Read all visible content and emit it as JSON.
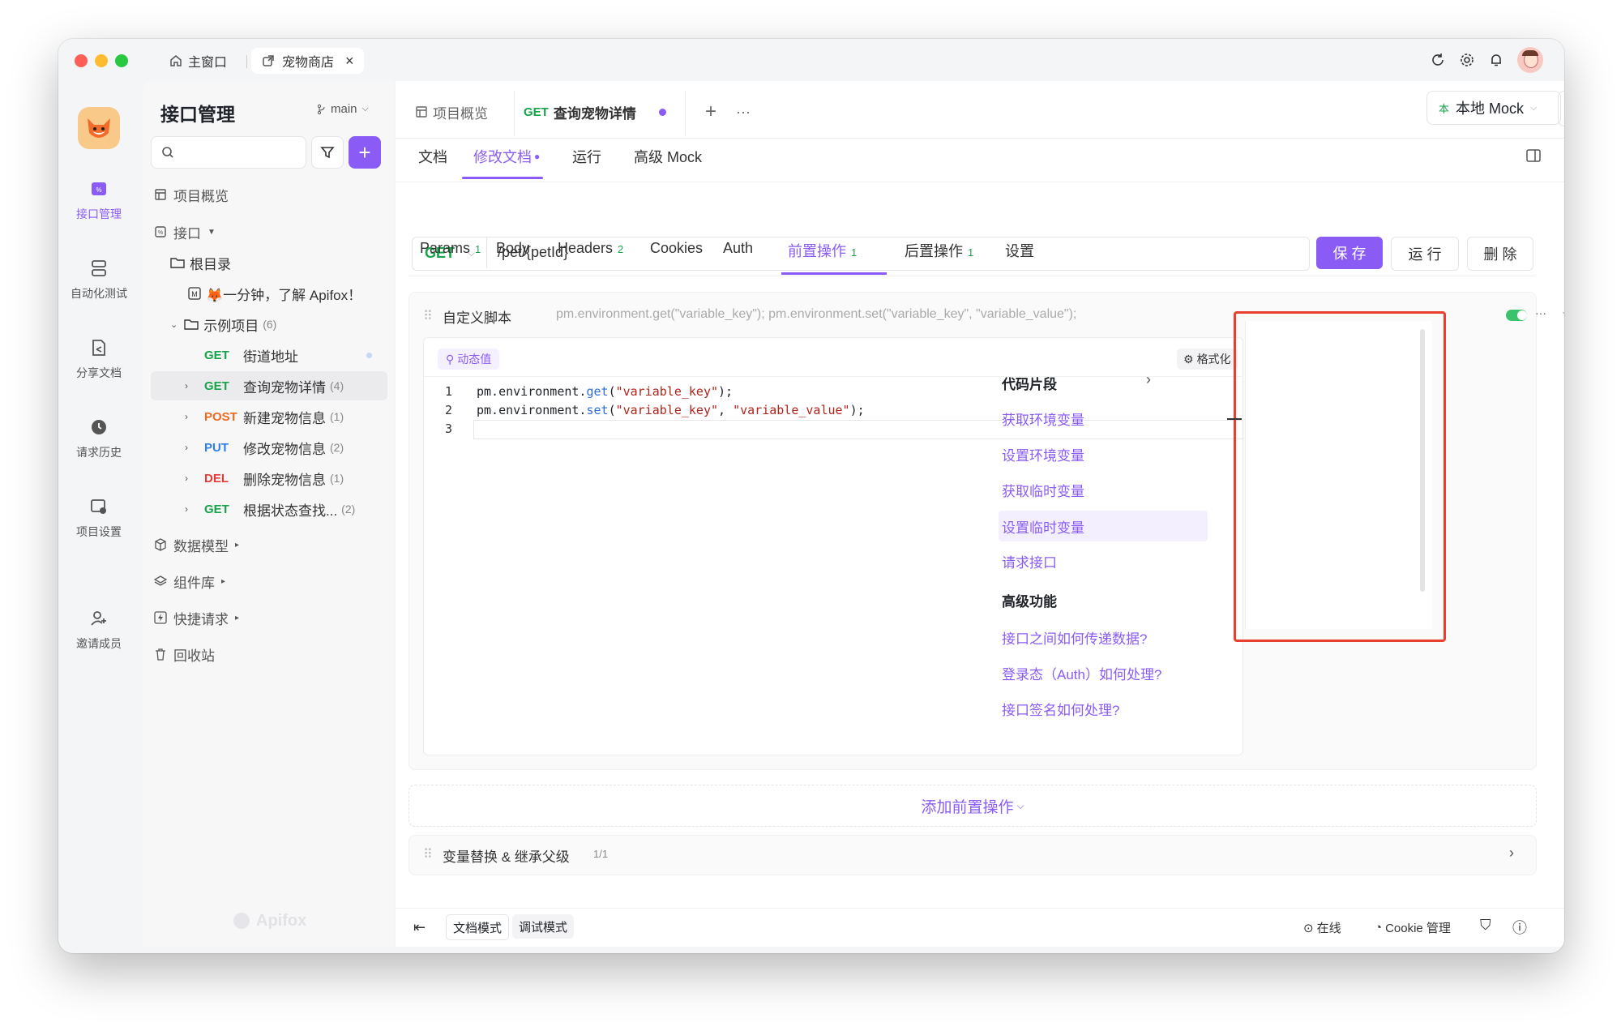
{
  "colors": {
    "accent": "#8a5cf5",
    "get": "#17a34a",
    "post": "#f2691e",
    "put": "#2f80ed",
    "delete": "#e53935",
    "highlight_border": "#e8402f"
  },
  "titlebar": {
    "tabs": [
      {
        "label": "主窗口",
        "icon": "home-icon"
      },
      {
        "label": "宠物商店",
        "icon": "external-link-icon"
      }
    ],
    "close_glyph": "×",
    "icons": [
      "refresh-icon",
      "settings-icon",
      "bell-icon",
      "avatar"
    ]
  },
  "rail": {
    "items": [
      {
        "label": "接口管理",
        "icon": "api-icon"
      },
      {
        "label": "自动化测试",
        "icon": "automation-icon"
      },
      {
        "label": "分享文档",
        "icon": "share-doc-icon"
      },
      {
        "label": "请求历史",
        "icon": "history-icon"
      },
      {
        "label": "项目设置",
        "icon": "project-settings-icon"
      },
      {
        "label": "邀请成员",
        "icon": "invite-icon"
      }
    ]
  },
  "sidebar": {
    "title": "接口管理",
    "branch": "main",
    "search_placeholder": "",
    "add_glyph": "+",
    "overview": "项目概览",
    "apis": "接口",
    "root": "根目录",
    "intro": "🦊一分钟，了解 Apifox！",
    "example": {
      "label": "示例项目",
      "count": "(6)"
    },
    "endpoints": [
      {
        "method": "GET",
        "label": "街道地址",
        "count": ""
      },
      {
        "method": "GET",
        "label": "查询宠物详情",
        "count": "(4)"
      },
      {
        "method": "POST",
        "label": "新建宠物信息",
        "count": "(1)"
      },
      {
        "method": "PUT",
        "label": "修改宠物信息",
        "count": "(2)"
      },
      {
        "method": "DEL",
        "label": "删除宠物信息",
        "count": "(1)"
      },
      {
        "method": "GET",
        "label": "根据状态查找...",
        "count": "(2)"
      }
    ],
    "data_models": "数据模型",
    "components": "组件库",
    "quick_request": "快捷请求",
    "recycle": "回收站",
    "watermark": "Apifox"
  },
  "main": {
    "overview_tab": "项目概览",
    "active_tab": {
      "method": "GET",
      "label": "查询宠物详情"
    },
    "add_glyph": "+",
    "more_glyph": "···",
    "env": {
      "badge": "本",
      "label": "本地 Mock"
    },
    "subtabs": {
      "doc": "文档",
      "edit": "修改文档",
      "run": "运行",
      "mock": "高级 Mock"
    },
    "request": {
      "method": "GET",
      "url": "/pet/{petId}"
    },
    "buttons": {
      "save": "保 存",
      "run": "运 行",
      "delete": "删 除"
    },
    "params_tabs": [
      {
        "label": "Params",
        "count": "1"
      },
      {
        "label": "Body",
        "count": ""
      },
      {
        "label": "Headers",
        "count": "2"
      },
      {
        "label": "Cookies",
        "count": ""
      },
      {
        "label": "Auth",
        "count": ""
      },
      {
        "label": "前置操作",
        "count": "1"
      },
      {
        "label": "后置操作",
        "count": "1"
      },
      {
        "label": "设置",
        "count": ""
      }
    ],
    "script": {
      "title": "自定义脚本",
      "preview": "pm.environment.get(\"variable_key\"); pm.environment.set(\"variable_key\", \"variable_value\");",
      "dynamic_value": "动态值",
      "format": "格式化",
      "line_numbers": [
        "1",
        "2",
        "3"
      ],
      "lines": [
        {
          "obj": "pm.environment.",
          "fn": "get",
          "args": [
            {
              "t": "str",
              "v": "\"variable_key\""
            }
          ],
          "tail": ");"
        },
        {
          "obj": "pm.environment.",
          "fn": "set",
          "args": [
            {
              "t": "str",
              "v": "\"variable_key\""
            },
            {
              "t": "sep",
              "v": ", "
            },
            {
              "t": "str",
              "v": "\"variable_value\""
            }
          ],
          "tail": ");"
        },
        {
          "obj": "",
          "fn": "",
          "args": [],
          "tail": ""
        }
      ]
    },
    "snippets": {
      "title": "代码片段",
      "items": [
        "获取环境变量",
        "设置环境变量",
        "获取临时变量",
        "设置临时变量",
        "请求接口"
      ],
      "advanced_title": "高级功能",
      "advanced": [
        "接口之间如何传递数据?",
        "登录态（Auth）如何处理?",
        "接口签名如何处理?"
      ]
    },
    "add_pre": "添加前置操作",
    "var_replace": {
      "label": "变量替换 & 继承父级",
      "count": "1/1"
    },
    "status": {
      "doc_mode": "文档模式",
      "debug_mode": "调试模式",
      "online": "在线",
      "cookie": "Cookie 管理"
    }
  }
}
